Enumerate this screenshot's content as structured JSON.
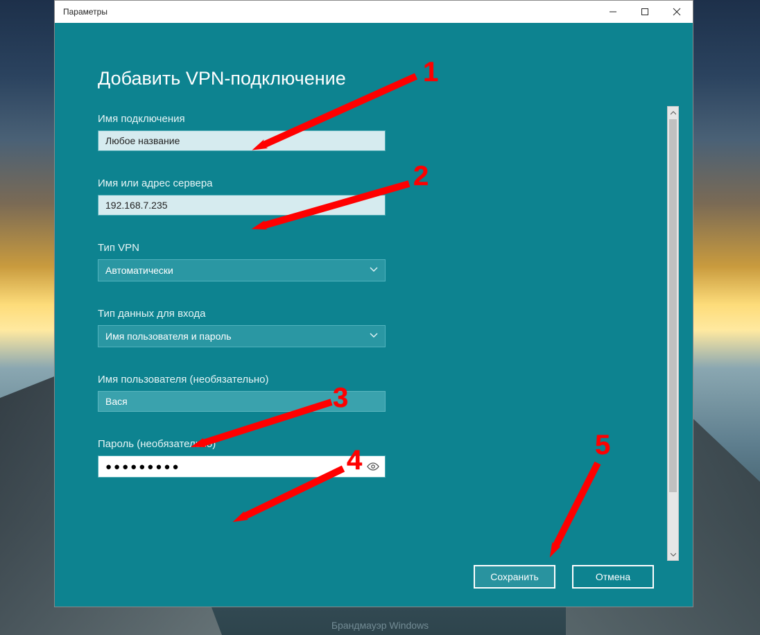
{
  "titlebar": {
    "title": "Параметры"
  },
  "page": {
    "heading": "Добавить VPN-подключение"
  },
  "fields": {
    "conn_name": {
      "label": "Имя подключения",
      "value": "Любое название"
    },
    "server": {
      "label": "Имя или адрес сервера",
      "value": "192.168.7.235"
    },
    "vpn_type": {
      "label": "Тип VPN",
      "value": "Автоматически"
    },
    "signin_type": {
      "label": "Тип данных для входа",
      "value": "Имя пользователя и пароль"
    },
    "username": {
      "label": "Имя пользователя (необязательно)",
      "value": "Вася"
    },
    "password": {
      "label": "Пароль (необязательно)",
      "value": "●●●●●●●●●"
    }
  },
  "buttons": {
    "save": "Сохранить",
    "cancel": "Отмена"
  },
  "annotations": {
    "n1": "1",
    "n2": "2",
    "n3": "3",
    "n4": "4",
    "n5": "5"
  },
  "bg_text": "Брандмауэр Windows"
}
